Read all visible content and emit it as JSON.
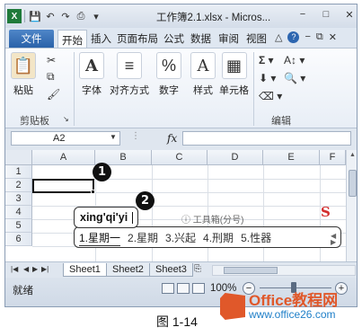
{
  "window": {
    "title": "工作簿2.1.xlsx - Micros...",
    "controls": {
      "minimize": "−",
      "restore": "□",
      "close": "✕"
    }
  },
  "qat": {
    "save": "💾",
    "undo": "↶",
    "redo": "↷",
    "print": "⎙"
  },
  "ribbon": {
    "file_tab": "文件",
    "tabs": [
      "开始",
      "插入",
      "页面布局",
      "公式",
      "数据",
      "审阅",
      "视图"
    ],
    "active_tab": "开始",
    "groups": {
      "clipboard": {
        "label": "剪贴板",
        "paste": "粘贴"
      },
      "font": "字体",
      "alignment": "对齐方式",
      "number": "数字",
      "styles": "样式",
      "cells": "单元格",
      "editing": "编辑"
    }
  },
  "formula_bar": {
    "name_box": "A2",
    "fx": "fx",
    "content": ""
  },
  "grid": {
    "columns": [
      "A",
      "B",
      "C",
      "D",
      "E",
      "F"
    ],
    "rows": [
      "1",
      "2",
      "3",
      "4",
      "5",
      "6"
    ],
    "active_cell": "A2"
  },
  "callouts": {
    "one": "1",
    "two": "2"
  },
  "ime": {
    "composition": "xing'qi'yi",
    "tip": "ⓘ 工具箱(分号)",
    "logo": "S",
    "candidates": [
      "1.星期一",
      "2.星期",
      "3.兴起",
      "4.刑期",
      "5.性器"
    ]
  },
  "sheets": {
    "tabs": [
      "Sheet1",
      "Sheet2",
      "Sheet3"
    ],
    "active": "Sheet1"
  },
  "status": {
    "ready": "就绪",
    "zoom": "100%",
    "zoom_level_percent": 100
  },
  "caption": "图 1-14",
  "watermark": {
    "line1": "Office教程网",
    "line2": "www.office26.com"
  }
}
